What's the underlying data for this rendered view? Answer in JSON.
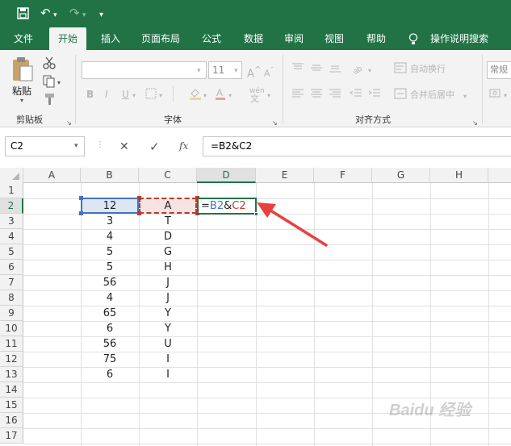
{
  "title_bar": {
    "undo_glyph": "↶",
    "redo_glyph": "↷",
    "customize_glyph": "▾"
  },
  "tabs": [
    "文件",
    "开始",
    "插入",
    "页面布局",
    "公式",
    "数据",
    "审阅",
    "视图",
    "帮助"
  ],
  "tell_me": "操作说明搜索",
  "ribbon": {
    "clipboard": {
      "paste_label": "粘贴",
      "group_label": "剪贴板"
    },
    "font": {
      "size": "11",
      "group_label": "字体",
      "bold": "B",
      "italic": "I",
      "underline": "U",
      "phonetic": "wén"
    },
    "alignment": {
      "wrap_text": "自动换行",
      "merge_center": "合并后居中",
      "group_label": "对齐方式"
    },
    "number": {
      "format": "常规"
    }
  },
  "formula_bar": {
    "name_box": "C2",
    "cancel": "✕",
    "enter": "✓",
    "fx": "fx",
    "formula": "=B2&C2"
  },
  "sheet": {
    "columns": [
      "A",
      "B",
      "C",
      "D",
      "E",
      "F",
      "G",
      "H"
    ],
    "rows": [
      "1",
      "2",
      "3",
      "4",
      "5",
      "6",
      "7",
      "8",
      "9",
      "10",
      "11",
      "12",
      "13",
      "14",
      "15",
      "16",
      "17"
    ],
    "col_b": [
      "12",
      "3",
      "4",
      "5",
      "5",
      "56",
      "4",
      "65",
      "6",
      "56",
      "75",
      "6"
    ],
    "col_c": [
      "A",
      "T",
      "D",
      "G",
      "H",
      "J",
      "J",
      "Y",
      "Y",
      "U",
      "I",
      "I"
    ],
    "d2": {
      "eq": "=",
      "ref1": "B2",
      "amp": "&",
      "ref2": "C2"
    }
  },
  "colors": {
    "excel_green": "#217346",
    "ref_blue": "#4472c4",
    "ref_red": "#c0392b",
    "arrow": "#e8423f"
  },
  "watermark": "Baidu 经验"
}
